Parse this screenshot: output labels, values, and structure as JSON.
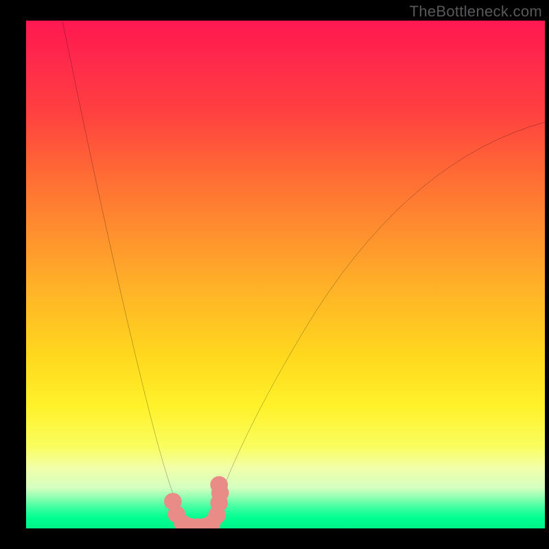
{
  "watermark": "TheBottleneck.com",
  "chart_data": {
    "type": "line",
    "title": "",
    "xlabel": "",
    "ylabel": "",
    "xlim": [
      0,
      100
    ],
    "ylim": [
      0,
      100
    ],
    "grid": false,
    "legend": false,
    "background_gradient": {
      "direction": "vertical",
      "stops": [
        {
          "pos": 0.0,
          "color": "#ff1850"
        },
        {
          "pos": 0.08,
          "color": "#ff2a4b"
        },
        {
          "pos": 0.18,
          "color": "#ff4040"
        },
        {
          "pos": 0.3,
          "color": "#ff6a35"
        },
        {
          "pos": 0.4,
          "color": "#ff8a2f"
        },
        {
          "pos": 0.52,
          "color": "#ffb028"
        },
        {
          "pos": 0.66,
          "color": "#ffd81e"
        },
        {
          "pos": 0.76,
          "color": "#fff22a"
        },
        {
          "pos": 0.84,
          "color": "#fafd60"
        },
        {
          "pos": 0.88,
          "color": "#f2ffa8"
        },
        {
          "pos": 0.92,
          "color": "#d4ffc0"
        },
        {
          "pos": 0.94,
          "color": "#8bffb0"
        },
        {
          "pos": 0.96,
          "color": "#3affa0"
        },
        {
          "pos": 0.98,
          "color": "#00ff90"
        },
        {
          "pos": 1.0,
          "color": "#00f388"
        }
      ]
    },
    "series": [
      {
        "name": "left-curve",
        "color": "#000000",
        "x": [
          7.0,
          9.0,
          11.0,
          13.0,
          15.0,
          17.0,
          19.0,
          21.0,
          23.0,
          25.0,
          27.0,
          28.5,
          30.0
        ],
        "y": [
          100.0,
          90.0,
          79.5,
          69.0,
          58.5,
          48.5,
          39.0,
          30.0,
          22.0,
          15.0,
          9.0,
          5.0,
          2.5
        ]
      },
      {
        "name": "right-curve",
        "color": "#000000",
        "x": [
          36.0,
          38.0,
          41.0,
          45.0,
          50.0,
          56.0,
          63.0,
          71.0,
          80.0,
          90.0,
          100.0
        ],
        "y": [
          2.5,
          7.0,
          14.0,
          23.0,
          33.0,
          43.0,
          53.0,
          62.0,
          69.5,
          75.5,
          80.0
        ]
      },
      {
        "name": "bottom-marker-points",
        "color": "#e98b86",
        "marker": "circle",
        "marker_size": 13,
        "x": [
          28.3,
          29.0,
          30.2,
          31.5,
          33.0,
          34.5,
          35.8,
          36.8,
          37.2,
          37.4,
          37.2
        ],
        "y": [
          5.3,
          2.8,
          1.0,
          0.4,
          0.3,
          0.4,
          1.0,
          2.6,
          5.0,
          7.0,
          8.6
        ]
      }
    ]
  }
}
